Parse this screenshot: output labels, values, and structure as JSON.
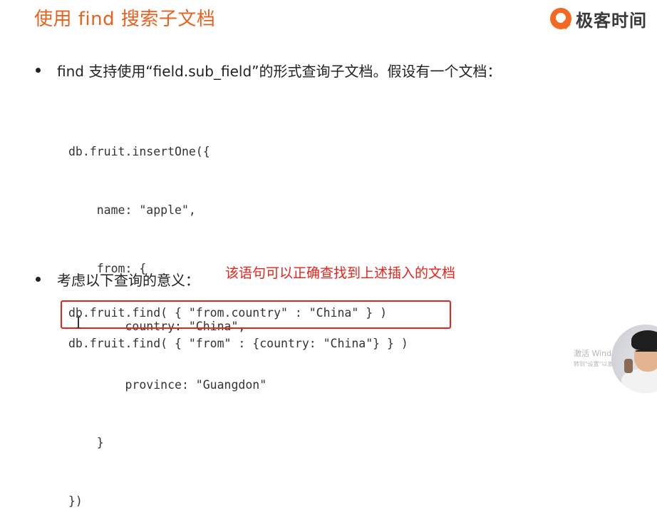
{
  "slide": {
    "title": "使用 find 搜索子文档",
    "brand": "极客时间"
  },
  "bullets": [
    {
      "text": "find 支持使用“field.sub_field”的形式查询子文档。假设有一个文档："
    },
    {
      "text": "考虑以下查询的意义："
    }
  ],
  "code_lines": [
    "db.fruit.insertOne({",
    "    name: \"apple\",",
    "    from: {",
    "        country: \"China\",",
    "        province: \"Guangdon\"",
    "    }",
    "})"
  ],
  "annotation": "该语句可以正确查找到上述插入的文档",
  "queries": [
    "db.fruit.find( { \"from.country\" : \"China\" } )",
    "db.fruit.find( { \"from\" : {country: \"China\"} } )"
  ],
  "watermark": {
    "line1": "激活 Windo",
    "line2": "转到\"设置\"以激"
  },
  "colors": {
    "title": "#e8621f",
    "annotation": "#e8231a",
    "highlight_border": "#e8231a",
    "brand_mark": "#f26a21"
  }
}
